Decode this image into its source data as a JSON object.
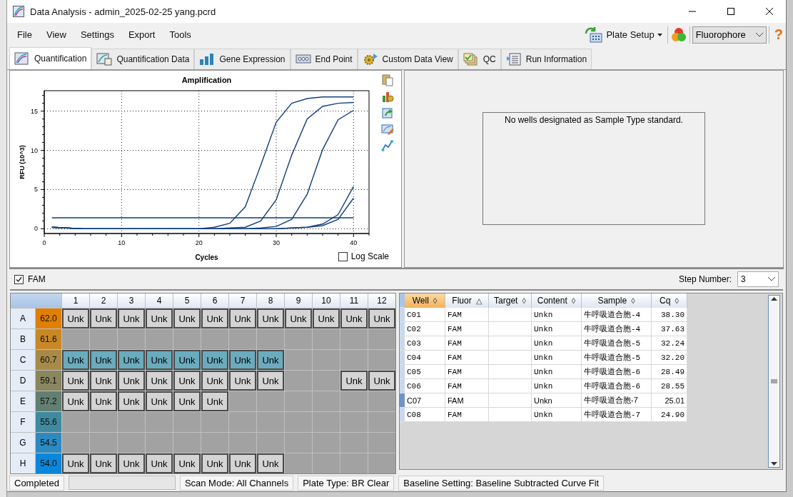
{
  "window": {
    "title": "Data Analysis - admin_2025-02-25 yang.pcrd"
  },
  "menu": [
    "File",
    "View",
    "Settings",
    "Export",
    "Tools"
  ],
  "toolbar": {
    "plate_setup": "Plate Setup",
    "view_select": "Fluorophore",
    "help": "?"
  },
  "tabs": [
    {
      "label": "Quantification",
      "selected": true
    },
    {
      "label": "Quantification Data",
      "selected": false
    },
    {
      "label": "Gene Expression",
      "selected": false
    },
    {
      "label": "End Point",
      "selected": false
    },
    {
      "label": "Custom Data View",
      "selected": false
    },
    {
      "label": "QC",
      "selected": false
    },
    {
      "label": "Run Information",
      "selected": false
    }
  ],
  "chart": {
    "chart_data": {
      "type": "line",
      "title": "Amplification",
      "xlabel": "Cycles",
      "ylabel": "RFU (10^3)",
      "grid": true,
      "x": [
        1,
        5,
        10,
        15,
        20,
        22,
        24,
        26,
        28,
        30,
        32,
        34,
        36,
        38,
        40
      ],
      "xlim": [
        0,
        42
      ],
      "ylim": [
        -0.6,
        17.6
      ],
      "xticks": [
        0,
        10,
        20,
        30,
        40
      ],
      "yticks": [
        0,
        5,
        10,
        15
      ],
      "series": [
        {
          "color": "#123f7c",
          "values": [
            0.2,
            0,
            0,
            0,
            0,
            0.2,
            0.7,
            2.8,
            8.1,
            13.6,
            16.0,
            16.6,
            16.8,
            16.8,
            16.8
          ]
        },
        {
          "color": "#123f7c",
          "values": [
            0.2,
            0,
            0,
            0,
            0,
            0,
            0.1,
            0.2,
            1.0,
            3.7,
            9.4,
            14.0,
            15.6,
            16.0,
            16.1
          ]
        },
        {
          "color": "#123f7c",
          "values": [
            0.2,
            0,
            0,
            0,
            0,
            0,
            0,
            0,
            0.1,
            0.3,
            1.2,
            4.4,
            10.1,
            13.9,
            15.1
          ]
        },
        {
          "color": "#123f7c",
          "values": [
            0.2,
            0,
            0,
            0,
            0,
            0,
            0,
            0,
            0,
            0,
            0.1,
            0.2,
            0.6,
            1.8,
            5.4
          ]
        },
        {
          "color": "#123f7c",
          "values": [
            0.2,
            0,
            0,
            0,
            0,
            0,
            0,
            0,
            0,
            0,
            0.1,
            0.2,
            0.4,
            1.2,
            3.9
          ]
        },
        {
          "color": "#0c3a78",
          "values": [
            1.4,
            1.4,
            1.4,
            1.4,
            1.4,
            1.4,
            1.4,
            1.4,
            1.4,
            1.4,
            1.4,
            1.4,
            1.4,
            1.4,
            1.4
          ]
        }
      ]
    },
    "log_scale": {
      "label": "Log Scale",
      "checked": false
    }
  },
  "standard_curve": {
    "message": "No wells designated as Sample Type standard."
  },
  "fluor_filter": {
    "label": "FAM",
    "checked": true
  },
  "step_number": {
    "label": "Step Number:",
    "value": "3"
  },
  "plate": {
    "columns": [
      "1",
      "2",
      "3",
      "4",
      "5",
      "6",
      "7",
      "8",
      "9",
      "10",
      "11",
      "12"
    ],
    "rows": [
      {
        "label": "A",
        "temp": "62.0",
        "color": "#e07f00",
        "wells": [
          {
            "kind": "sample",
            "text": "Unk",
            "selected": false
          },
          {
            "kind": "sample",
            "text": "Unk",
            "selected": false
          },
          {
            "kind": "sample",
            "text": "Unk",
            "selected": false
          },
          {
            "kind": "sample",
            "text": "Unk",
            "selected": false
          },
          {
            "kind": "sample",
            "text": "Unk",
            "selected": false
          },
          {
            "kind": "sample",
            "text": "Unk",
            "selected": false
          },
          {
            "kind": "sample",
            "text": "Unk",
            "selected": false
          },
          {
            "kind": "sample",
            "text": "Unk",
            "selected": false
          },
          {
            "kind": "sample",
            "text": "Unk",
            "selected": false
          },
          {
            "kind": "sample",
            "text": "Unk",
            "selected": false
          },
          {
            "kind": "sample",
            "text": "Unk",
            "selected": false
          },
          {
            "kind": "sample",
            "text": "Unk",
            "selected": false
          }
        ]
      },
      {
        "label": "B",
        "temp": "61.6",
        "color": "#c98826",
        "wells": [
          {
            "kind": "empty"
          },
          {
            "kind": "empty"
          },
          {
            "kind": "empty"
          },
          {
            "kind": "empty"
          },
          {
            "kind": "empty"
          },
          {
            "kind": "empty"
          },
          {
            "kind": "empty"
          },
          {
            "kind": "empty"
          },
          {
            "kind": "empty"
          },
          {
            "kind": "empty"
          },
          {
            "kind": "empty"
          },
          {
            "kind": "empty"
          }
        ]
      },
      {
        "label": "C",
        "temp": "60.7",
        "color": "#a88a48",
        "wells": [
          {
            "kind": "sample",
            "text": "Unk",
            "selected": true
          },
          {
            "kind": "sample",
            "text": "Unk",
            "selected": true
          },
          {
            "kind": "sample",
            "text": "Unk",
            "selected": true
          },
          {
            "kind": "sample",
            "text": "Unk",
            "selected": true
          },
          {
            "kind": "sample",
            "text": "Unk",
            "selected": true
          },
          {
            "kind": "sample",
            "text": "Unk",
            "selected": true
          },
          {
            "kind": "sample",
            "text": "Unk",
            "selected": true
          },
          {
            "kind": "sample",
            "text": "Unk",
            "selected": true
          },
          {
            "kind": "empty"
          },
          {
            "kind": "empty"
          },
          {
            "kind": "empty"
          },
          {
            "kind": "empty"
          }
        ]
      },
      {
        "label": "D",
        "temp": "59.1",
        "color": "#8a865e",
        "wells": [
          {
            "kind": "sample",
            "text": "Unk",
            "selected": false
          },
          {
            "kind": "sample",
            "text": "Unk",
            "selected": false
          },
          {
            "kind": "sample",
            "text": "Unk",
            "selected": false
          },
          {
            "kind": "sample",
            "text": "Unk",
            "selected": false
          },
          {
            "kind": "sample",
            "text": "Unk",
            "selected": false
          },
          {
            "kind": "sample",
            "text": "Unk",
            "selected": false
          },
          {
            "kind": "sample",
            "text": "Unk",
            "selected": false
          },
          {
            "kind": "sample",
            "text": "Unk",
            "selected": false
          },
          {
            "kind": "empty"
          },
          {
            "kind": "empty"
          },
          {
            "kind": "sample",
            "text": "Unk",
            "selected": false
          },
          {
            "kind": "sample",
            "text": "Unk",
            "selected": false
          }
        ]
      },
      {
        "label": "E",
        "temp": "57.2",
        "color": "#627f72",
        "wells": [
          {
            "kind": "sample",
            "text": "Unk",
            "selected": false
          },
          {
            "kind": "sample",
            "text": "Unk",
            "selected": false
          },
          {
            "kind": "sample",
            "text": "Unk",
            "selected": false
          },
          {
            "kind": "sample",
            "text": "Unk",
            "selected": false
          },
          {
            "kind": "sample",
            "text": "Unk",
            "selected": false
          },
          {
            "kind": "sample",
            "text": "Unk",
            "selected": false
          },
          {
            "kind": "empty"
          },
          {
            "kind": "empty"
          },
          {
            "kind": "empty"
          },
          {
            "kind": "empty"
          },
          {
            "kind": "empty"
          },
          {
            "kind": "empty"
          }
        ]
      },
      {
        "label": "F",
        "temp": "55.6",
        "color": "#3f8a9e",
        "wells": [
          {
            "kind": "empty"
          },
          {
            "kind": "empty"
          },
          {
            "kind": "empty"
          },
          {
            "kind": "empty"
          },
          {
            "kind": "empty"
          },
          {
            "kind": "empty"
          },
          {
            "kind": "empty"
          },
          {
            "kind": "empty"
          },
          {
            "kind": "empty"
          },
          {
            "kind": "empty"
          },
          {
            "kind": "empty"
          },
          {
            "kind": "empty"
          }
        ]
      },
      {
        "label": "G",
        "temp": "54.5",
        "color": "#2d8ac0",
        "wells": [
          {
            "kind": "empty"
          },
          {
            "kind": "empty"
          },
          {
            "kind": "empty"
          },
          {
            "kind": "empty"
          },
          {
            "kind": "empty"
          },
          {
            "kind": "empty"
          },
          {
            "kind": "empty"
          },
          {
            "kind": "empty"
          },
          {
            "kind": "empty"
          },
          {
            "kind": "empty"
          },
          {
            "kind": "empty"
          },
          {
            "kind": "empty"
          }
        ]
      },
      {
        "label": "H",
        "temp": "54.0",
        "color": "#0a86da",
        "wells": [
          {
            "kind": "sample",
            "text": "Unk",
            "selected": false
          },
          {
            "kind": "sample",
            "text": "Unk",
            "selected": false
          },
          {
            "kind": "sample",
            "text": "Unk",
            "selected": false
          },
          {
            "kind": "sample",
            "text": "Unk",
            "selected": false
          },
          {
            "kind": "sample",
            "text": "Unk",
            "selected": false
          },
          {
            "kind": "sample",
            "text": "Unk",
            "selected": false
          },
          {
            "kind": "sample",
            "text": "Unk",
            "selected": false
          },
          {
            "kind": "sample",
            "text": "Unk",
            "selected": false
          },
          {
            "kind": "empty"
          },
          {
            "kind": "empty"
          },
          {
            "kind": "empty"
          },
          {
            "kind": "empty"
          }
        ]
      }
    ]
  },
  "table": {
    "columns": [
      {
        "label": "Well",
        "sort_icon": "◊",
        "selected": true
      },
      {
        "label": "Fluor",
        "sort_icon": "△",
        "selected": false
      },
      {
        "label": "Target",
        "sort_icon": "◊",
        "selected": false
      },
      {
        "label": "Content",
        "sort_icon": "◊",
        "selected": false
      },
      {
        "label": "Sample",
        "sort_icon": "◊",
        "selected": false
      },
      {
        "label": "Cq",
        "sort_icon": "◊",
        "selected": false
      }
    ],
    "rows": [
      {
        "well": "C01",
        "fluor": "FAM",
        "content": "Unkn",
        "sample": "牛呼吸道合胞-4",
        "cq": "38.30",
        "selected": false
      },
      {
        "well": "C02",
        "fluor": "FAM",
        "content": "Unkn",
        "sample": "牛呼吸道合胞-4",
        "cq": "37.63",
        "selected": false
      },
      {
        "well": "C03",
        "fluor": "FAM",
        "content": "Unkn",
        "sample": "牛呼吸道合胞-5",
        "cq": "32.24",
        "selected": false
      },
      {
        "well": "C04",
        "fluor": "FAM",
        "content": "Unkn",
        "sample": "牛呼吸道合胞-5",
        "cq": "32.20",
        "selected": false
      },
      {
        "well": "C05",
        "fluor": "FAM",
        "content": "Unkn",
        "sample": "牛呼吸道合胞-6",
        "cq": "28.49",
        "selected": false
      },
      {
        "well": "C06",
        "fluor": "FAM",
        "content": "Unkn",
        "sample": "牛呼吸道合胞-6",
        "cq": "28.55",
        "selected": false
      },
      {
        "well": "C07",
        "fluor": "FAM",
        "content": "Unkn",
        "sample": "牛呼吸道合胞-7",
        "cq": "25.01",
        "selected": true
      },
      {
        "well": "C08",
        "fluor": "FAM",
        "content": "Unkn",
        "sample": "牛呼吸道合胞-7",
        "cq": "24.90",
        "selected": false
      }
    ]
  },
  "status_bar": {
    "state": "Completed",
    "scan_mode": "Scan Mode: All Channels",
    "plate_type": "Plate Type: BR Clear",
    "baseline": "Baseline Setting: Baseline Subtracted Curve Fit"
  }
}
